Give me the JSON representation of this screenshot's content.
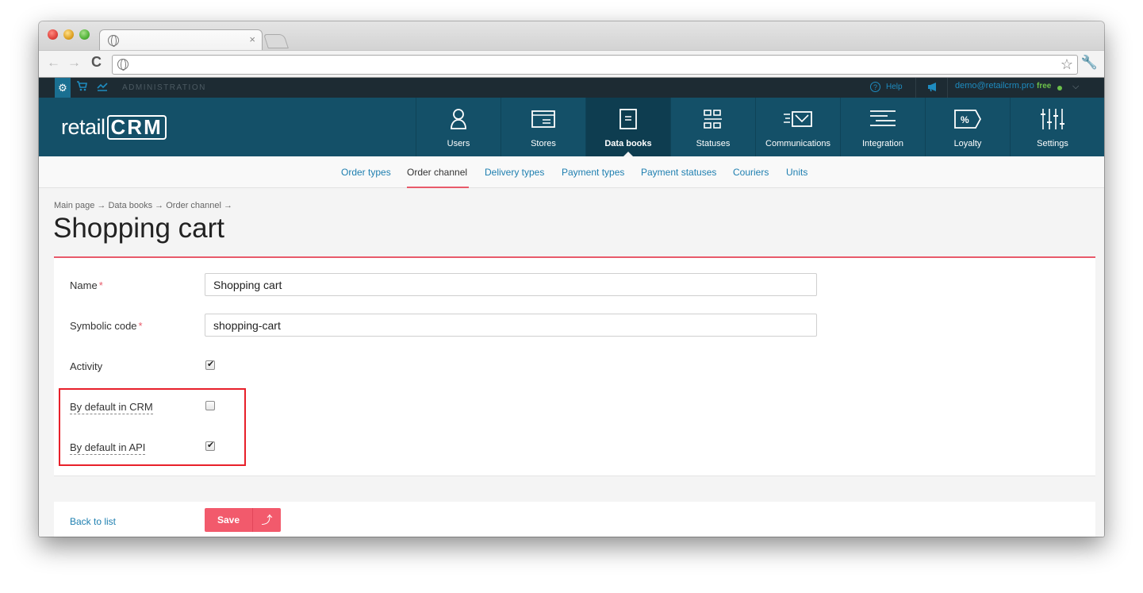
{
  "browser": {
    "tab_close": "×",
    "nav_back": "←",
    "nav_forward": "→",
    "reload": "C",
    "star": "☆",
    "wrench": "🔧"
  },
  "admin_bar": {
    "section_label": "ADMINISTRATION",
    "help_icon": "?",
    "help_label": "Help",
    "user_email": "demo@retailcrm.pro",
    "plan": "free",
    "chevron": "⌵"
  },
  "logo": {
    "text_before": "retail",
    "text_crm": "CRM"
  },
  "main_nav": [
    {
      "label": "Users",
      "icon": "user-icon"
    },
    {
      "label": "Stores",
      "icon": "store-icon"
    },
    {
      "label": "Data books",
      "icon": "document-icon",
      "active": true
    },
    {
      "label": "Statuses",
      "icon": "statuses-icon"
    },
    {
      "label": "Communications",
      "icon": "envelope-icon"
    },
    {
      "label": "Integration",
      "icon": "integration-icon"
    },
    {
      "label": "Loyalty",
      "icon": "percent-tag-icon"
    },
    {
      "label": "Settings",
      "icon": "sliders-icon"
    }
  ],
  "sub_nav": [
    {
      "label": "Order types"
    },
    {
      "label": "Order channel",
      "active": true
    },
    {
      "label": "Delivery types"
    },
    {
      "label": "Payment types"
    },
    {
      "label": "Payment statuses"
    },
    {
      "label": "Couriers"
    },
    {
      "label": "Units"
    }
  ],
  "breadcrumb": "Main page → Data books → Order channel →",
  "page_title": "Shopping cart",
  "form": {
    "name_label": "Name",
    "name_value": "Shopping cart",
    "code_label": "Symbolic code",
    "code_value": "shopping-cart",
    "activity_label": "Activity",
    "activity_checked": true,
    "default_crm_label": "By default in CRM",
    "default_crm_checked": false,
    "default_api_label": "By default in API",
    "default_api_checked": true,
    "required_mark": "*"
  },
  "footer": {
    "back_label": "Back to list",
    "save_label": "Save",
    "save_extra_icon": "⤴"
  },
  "colors": {
    "header_bg": "#145068",
    "admin_bar_bg": "#1d2b33",
    "accent": "#e85a6a",
    "link": "#1e7fb0",
    "highlight": "#e8202a"
  }
}
